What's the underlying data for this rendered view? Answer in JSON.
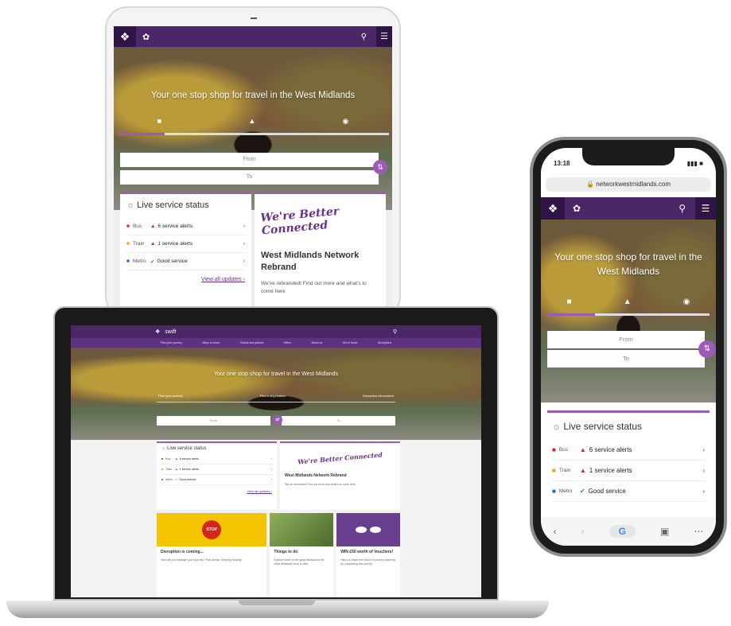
{
  "tablet": {
    "hero_title": "Your one stop shop for travel in the West Midlands",
    "from_placeholder": "From",
    "to_placeholder": "To",
    "live_title": "Live service status",
    "status_rows": [
      {
        "mode": "Bus",
        "text": "6 service alerts",
        "kind": "alert"
      },
      {
        "mode": "Train",
        "text": "1 service alerts",
        "kind": "alert"
      },
      {
        "mode": "Metro",
        "text": "Good service",
        "kind": "good"
      }
    ],
    "view_all": "View all updates ›",
    "brand_script": "We're Better Connected",
    "news_title": "West Midlands Network Rebrand",
    "news_sub": "We've rebranded! Find out more and what's to come here"
  },
  "laptop": {
    "brand": "swift",
    "menu_items": [
      "Plan your journey",
      "Ways to travel",
      "Tickets and passes",
      "Offers",
      "About us",
      "Get in touch",
      "Disruptions"
    ],
    "hero_title": "Your one stop shop for travel in the West Midlands",
    "tabs": [
      "Plan your journey",
      "Find a stop/station",
      "Disruption information"
    ],
    "from_placeholder": "From",
    "to_placeholder": "To",
    "live_title": "Live service status",
    "status_rows": [
      {
        "mode": "Bus",
        "text": "6 service alerts",
        "kind": "alert"
      },
      {
        "mode": "Train",
        "text": "1 service alerts",
        "kind": "alert"
      },
      {
        "mode": "Metro",
        "text": "Good service",
        "kind": "good"
      }
    ],
    "view_all": "View all updates ›",
    "brand_script": "We're Better Connected",
    "news_title": "West Midlands Network Rebrand",
    "news_sub": "We've rebranded! Find out more and what's to come here",
    "tiles": [
      {
        "title": "Disruption is coming...",
        "sub": "How will you manage your journey? Plan ahead. Keeping Moving!",
        "color": "#f4c400"
      },
      {
        "title": "Things to do",
        "sub": "Explore some of the great attractions the West Midlands have to offer",
        "color": "#5a7a3a"
      },
      {
        "title": "WIN £50 worth of Vouchers!",
        "sub": "Help us shape the future of journey planning by completing this survey",
        "color": "#6b3f8f"
      }
    ]
  },
  "phone": {
    "time": "13:18",
    "url": "networkwestmidlands.com",
    "hero_title": "Your one stop shop for travel in the West Midlands",
    "from_placeholder": "From",
    "to_placeholder": "To",
    "live_title": "Live service status",
    "status_rows": [
      {
        "mode": "Bus",
        "text": "6 service alerts",
        "kind": "alert"
      },
      {
        "mode": "Train",
        "text": "1 service alerts",
        "kind": "alert"
      },
      {
        "mode": "Metro",
        "text": "Good service",
        "kind": "good"
      }
    ],
    "toolbar": [
      "back-icon",
      "forward-icon",
      "google-icon",
      "tabs-icon",
      "more-icon"
    ]
  },
  "colors": {
    "brand_purple": "#4b2768",
    "accent_purple": "#9d5bb8",
    "alert_red": "#d6261c",
    "good_green": "#2a9d3a"
  }
}
